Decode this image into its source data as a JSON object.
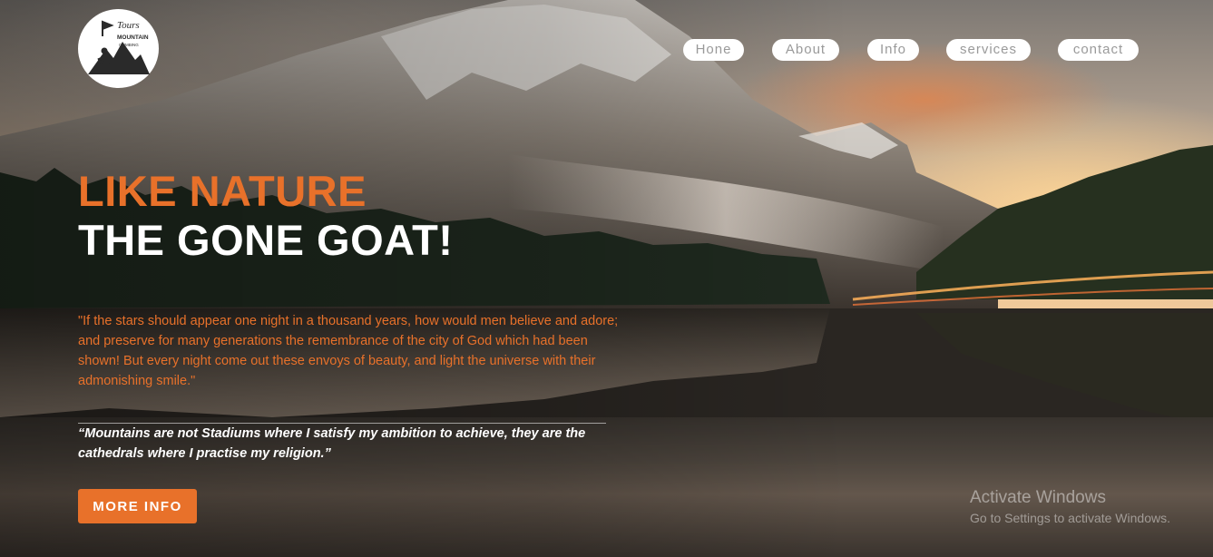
{
  "brand": {
    "logo_text_top": "Tours",
    "logo_text_main": "MOUNTAIN",
    "logo_text_sub": "CLIMBING"
  },
  "nav": {
    "items": [
      {
        "label": "Hone"
      },
      {
        "label": "About"
      },
      {
        "label": "Info"
      },
      {
        "label": "services"
      },
      {
        "label": "contact"
      }
    ]
  },
  "hero": {
    "headline_1": "LIKE NATURE",
    "headline_2": "THE GONE GOAT!",
    "quote": "\"If the stars should appear one night in a thousand years, how would men believe and adore; and preserve for many generations the remembrance of the city of God which had been shown! But every night come out these envoys of beauty, and light the universe with their admonishing smile.\"",
    "quote_2": "“Mountains are not Stadiums where I satisfy my ambition to achieve, they are the cathedrals where I practise my religion.”",
    "cta_label": "MORE INFO"
  },
  "watermark": {
    "title": "Activate Windows",
    "subtitle": "Go to Settings to activate Windows."
  },
  "colors": {
    "accent": "#e8712a",
    "nav_bg": "#ffffff",
    "nav_text": "#9a9a9a"
  },
  "icons": {
    "logo": "mountain-climber-logo"
  }
}
